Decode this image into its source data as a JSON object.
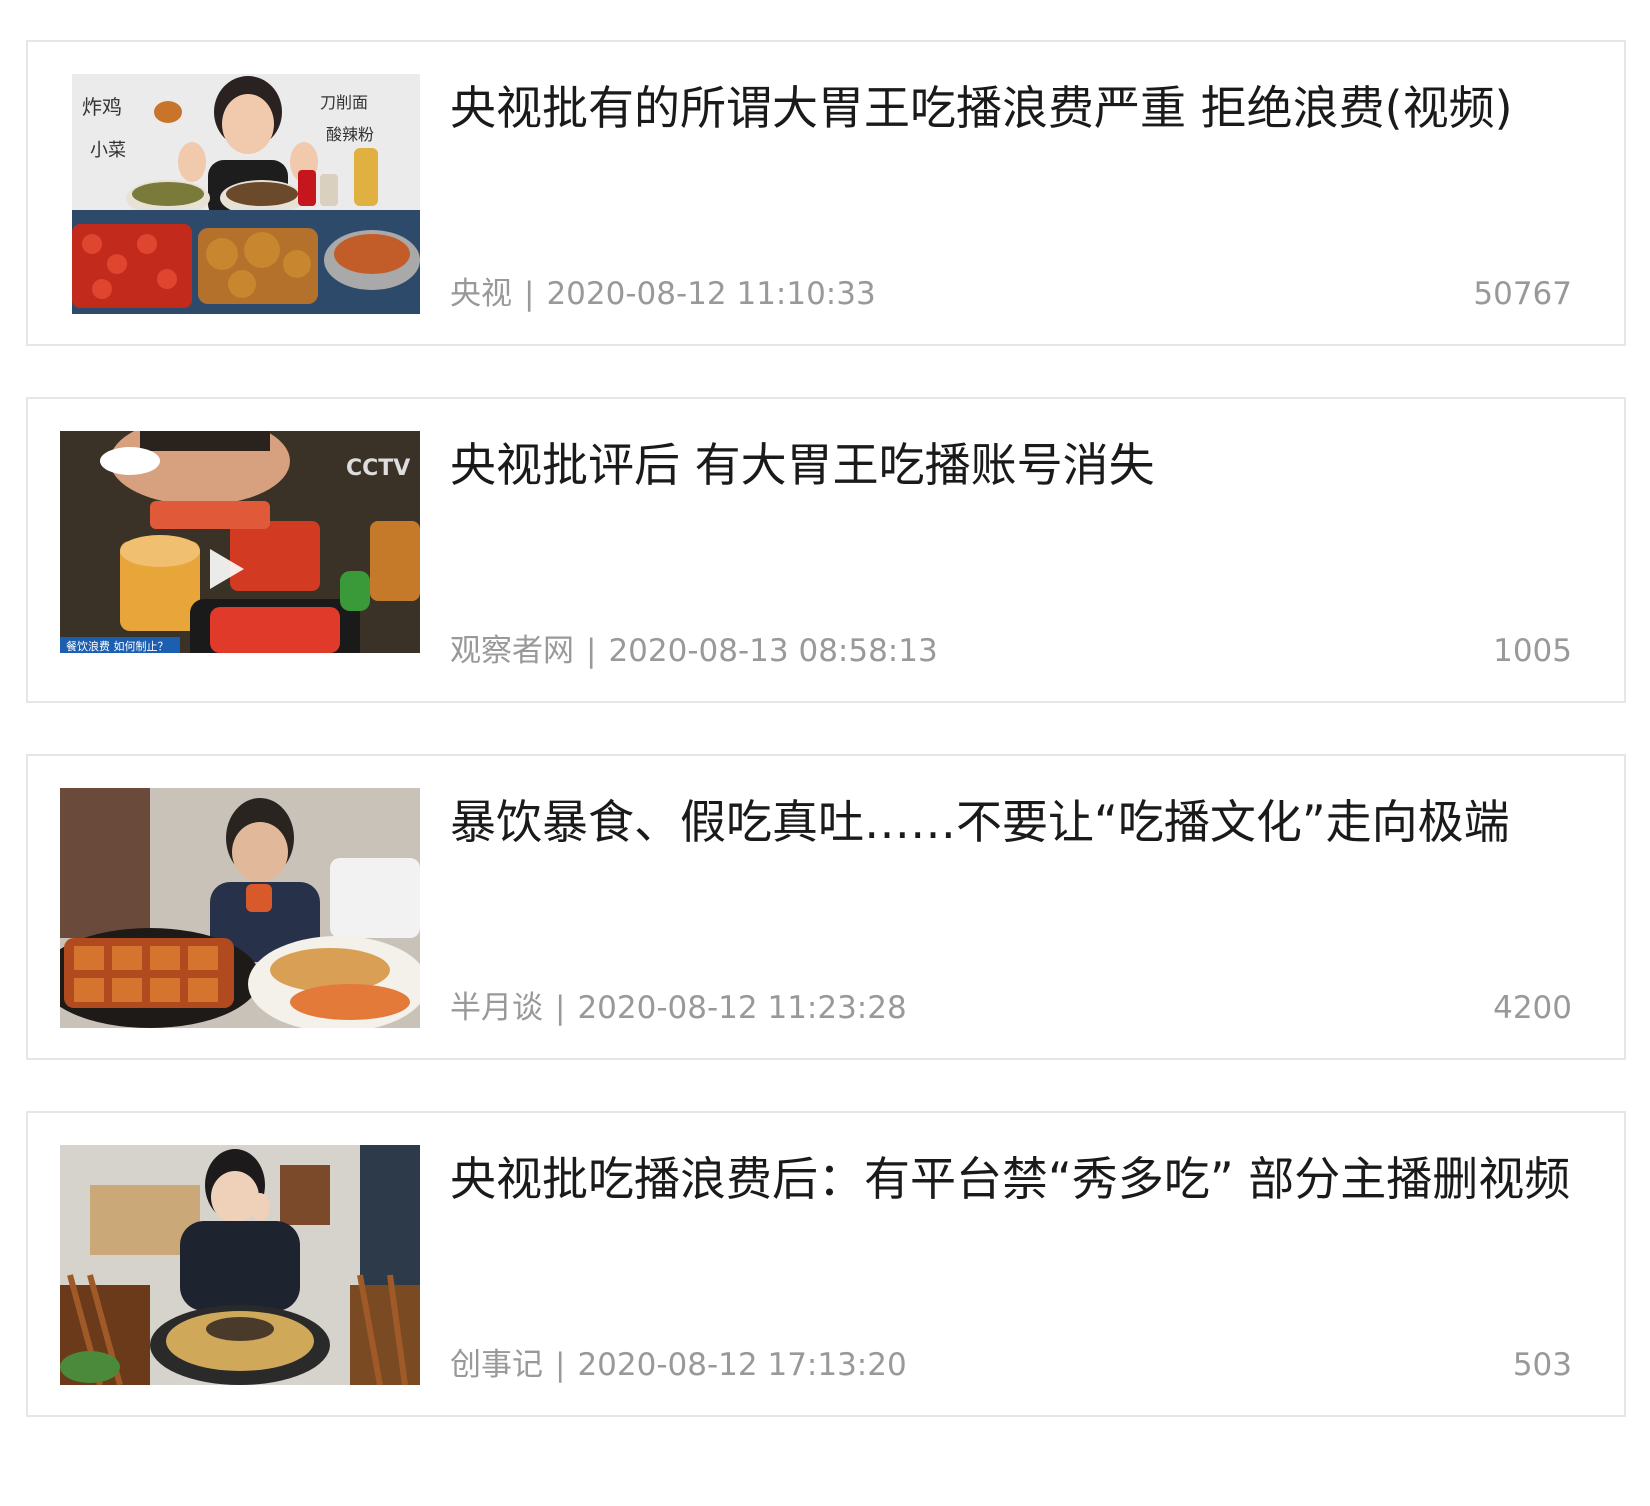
{
  "articles": [
    {
      "title": "央视批有的所谓大胃王吃播浪费严重 拒绝浪费(视频)",
      "source": "央视",
      "separator": "|",
      "time": "2020-08-12 11:10:33",
      "count": "50767",
      "thumb_text": {
        "line1": "炸鸡",
        "line2": "小菜",
        "line3": "刀削面",
        "line4": "酸辣粉"
      }
    },
    {
      "title": "央视批评后 有大胃王吃播账号消失",
      "source": "观察者网",
      "separator": "|",
      "time": "2020-08-13 08:58:13",
      "count": "1005",
      "thumb_text": {
        "logo": "CCTV",
        "caption": "餐饮浪费 如何制止？"
      }
    },
    {
      "title": "暴饮暴食、假吃真吐……不要让“吃播文化”走向极端",
      "source": "半月谈",
      "separator": "|",
      "time": "2020-08-12 11:23:28",
      "count": "4200"
    },
    {
      "title": "央视批吃播浪费后：有平台禁“秀多吃” 部分主播删视频",
      "source": "创事记",
      "separator": "|",
      "time": "2020-08-12 17:13:20",
      "count": "503"
    }
  ]
}
